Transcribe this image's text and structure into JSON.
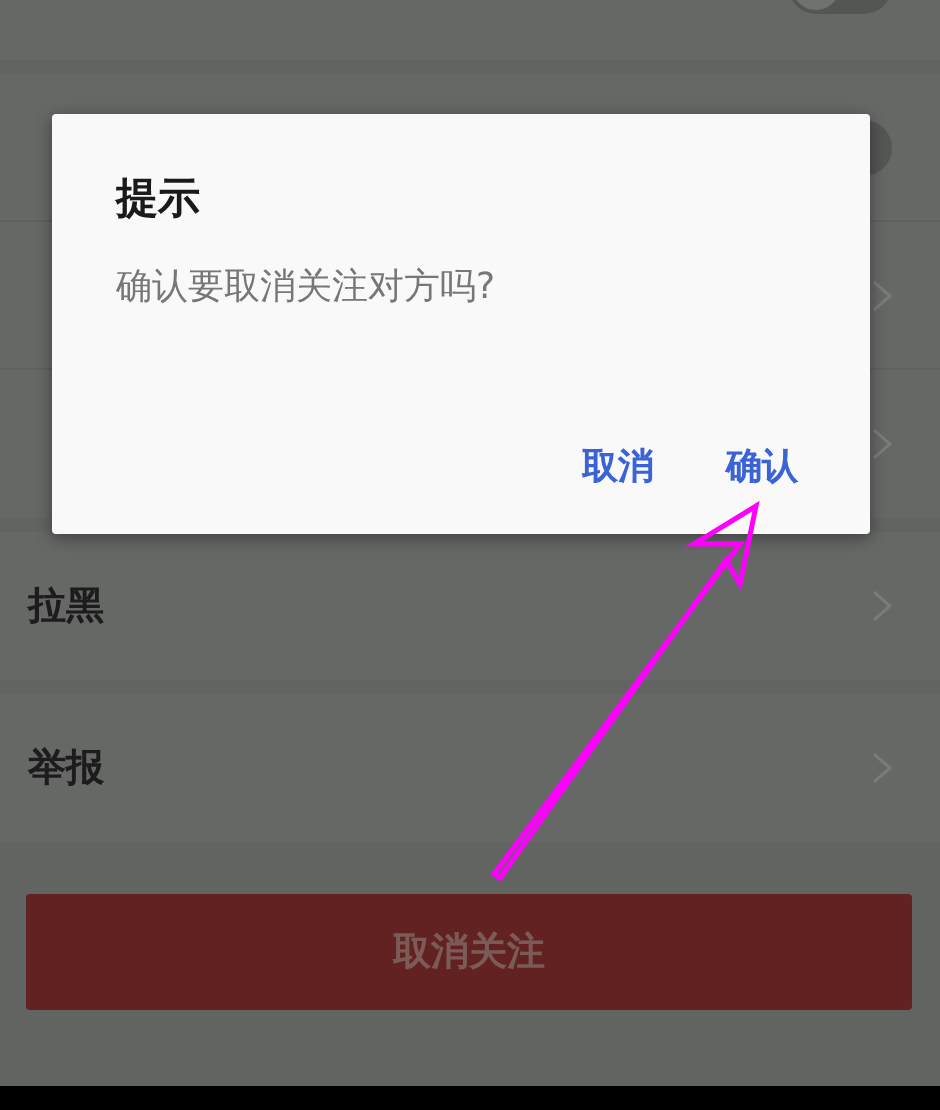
{
  "settings": [
    {
      "kind": "toggle",
      "on": false
    },
    {
      "kind": "toggle",
      "on": false
    },
    {
      "kind": "link"
    },
    {
      "kind": "link"
    },
    {
      "kind": "link",
      "label": "拉黑"
    },
    {
      "kind": "link",
      "label": "举报"
    }
  ],
  "unfollow_button": "取消关注",
  "dialog": {
    "title": "提示",
    "message": "确认要取消关注对方吗?",
    "buttons": [
      {
        "label": "取消"
      },
      {
        "label": "确认"
      }
    ]
  }
}
